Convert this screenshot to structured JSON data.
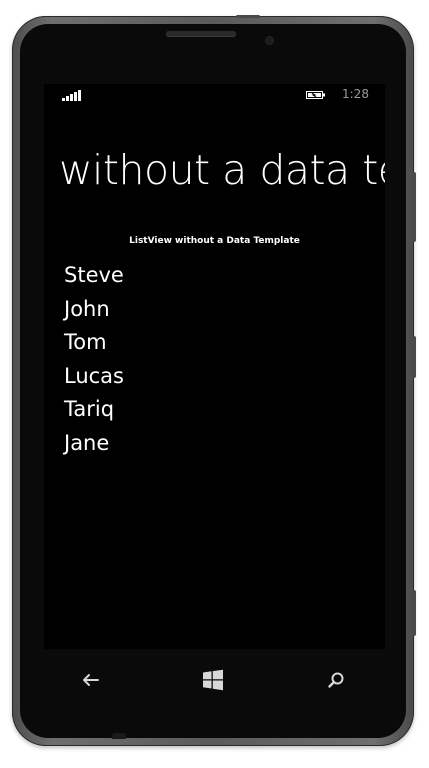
{
  "status_bar": {
    "time": "1:28",
    "icons": [
      "signal-icon",
      "battery-icon"
    ]
  },
  "page": {
    "title": "without a data te"
  },
  "list_view": {
    "header": "ListView without a Data Template",
    "items": [
      "Steve",
      "John",
      "Tom",
      "Lucas",
      "Tariq",
      "Jane"
    ]
  },
  "nav_bar": {
    "buttons": [
      "back-icon",
      "windows-start-icon",
      "search-icon"
    ]
  },
  "colors": {
    "background": "#000000",
    "foreground": "#ffffff",
    "phone_frame": "#5b5b5b"
  }
}
